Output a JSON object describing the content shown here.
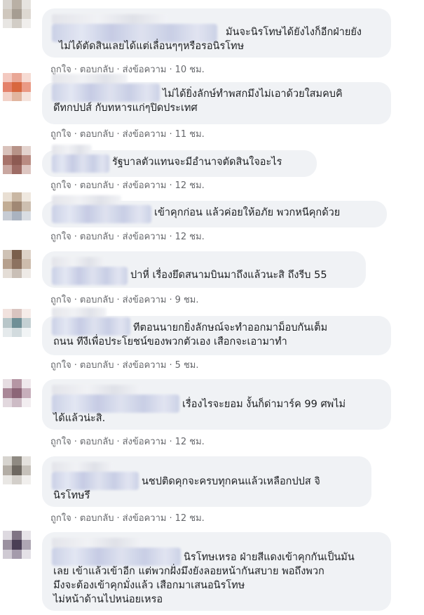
{
  "actions": {
    "like": "ถูกใจ",
    "reply": "ตอบกลับ",
    "send": "ส่งข้อความ",
    "sep": "·"
  },
  "comments": [
    {
      "text": "มันจะนิรโทษได้ยังไงก็อีกฝ่ายยัง\nไม่ได้ตัดสินเลยได้แต่เลื่อนๆๆหรือรอนิรโทษ",
      "time": "10 ชม."
    },
    {
      "text": "ไม่ได้ยิ่งลักษ์ทำพสกมึงไม่เอาด้วยใสมคบคิ\nดึทกปปส์ กับทหารแก่ๆปิดประเทศ",
      "time": "11 ชม."
    },
    {
      "text": "รัฐบาลตัวแทนจะมีอำนาจตัดสินใจอะไร",
      "time": "12 ชม."
    },
    {
      "text": "เข้าคุกก่อน แล้วค่อยให้อภัย พวกหนีคุกด้วย",
      "time": "12 ชม."
    },
    {
      "text": "ปาหี่ เรื่องยึดสนามบินมาถึงแล้วนะสิ ถึงรีบ 55",
      "time": "9 ชม."
    },
    {
      "text": "ทีตอนนายกยิ่งลักษณ์จะทำออกมาม็อบกันเต็ม\nถนน ทีงีเพื่อประโยชน์ของพวกตัวเอง เสือกจะเอามาทำ",
      "time": "5 ชม."
    },
    {
      "text": "เรื่องไรจะยอม งั้นก็ด่ามาร์ค 99 ศพไม่\nได้แล้วน่ะสิ.",
      "time": "12 ชม."
    },
    {
      "text": "นชปติดคุกจะครบทุกคนแล้วเหลือกปปส จิ\nนิรโทษรึ",
      "time": "12 ชม."
    },
    {
      "text": "นิรโทษเหรอ ฝ่ายสีแดงเข้าคุกกันเป็นมัน\nเลย เข้าแล้วเข้าอีก แต่พวกฝั่งมึงยังลอยหน้ากันสบาย พอถึงพวก\nมึงจะต้องเข้าคุกมั่งแล้ว เสือกมาเสนอนิรโทษ\nไม่หน้าด้านไปหน่อยเหรอ",
      "time": ""
    }
  ]
}
